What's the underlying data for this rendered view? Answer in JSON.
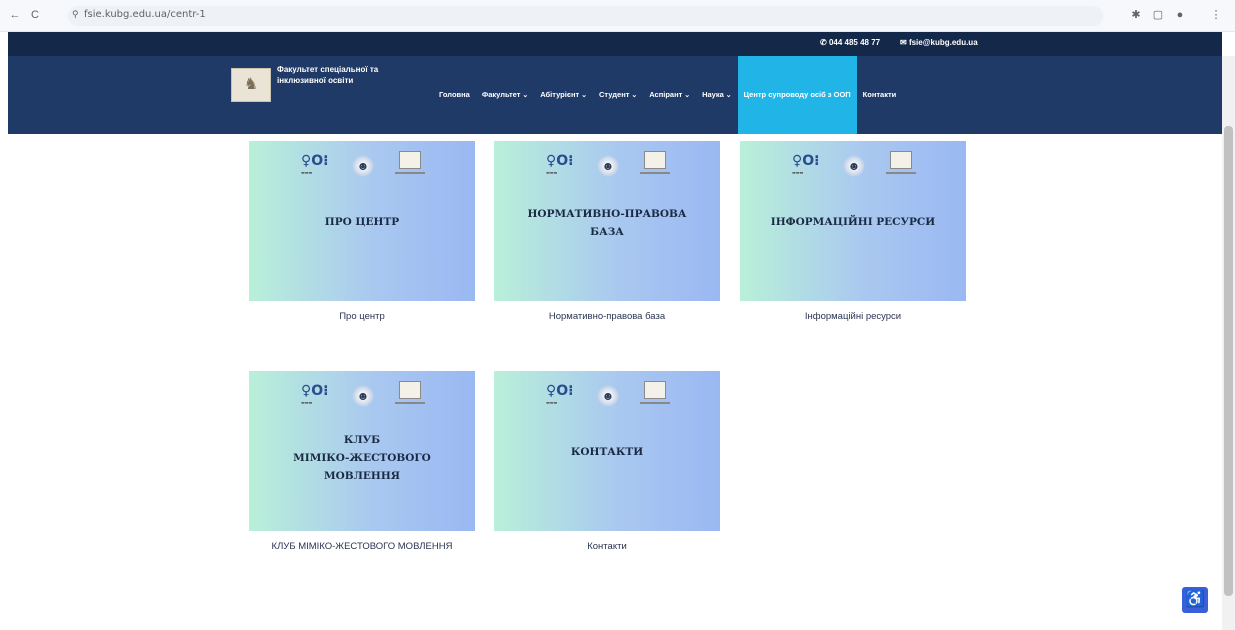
{
  "browser": {
    "back": "←",
    "reload": "C",
    "url": "fsie.kubg.edu.ua/centr-1",
    "right_icons": [
      "puzzle-icon",
      "window-icon",
      "profile-icon",
      "menu-icon"
    ]
  },
  "top_strip": {
    "phone": "044 485 48 77",
    "email": "fsie@kubg.edu.ua"
  },
  "header": {
    "logo_text": "Факультет спеціальної та інклюзивної освіти",
    "menu": [
      {
        "label": "Головна",
        "has_dropdown": false
      },
      {
        "label": "Факультет",
        "has_dropdown": true
      },
      {
        "label": "Абітурієнт",
        "has_dropdown": true
      },
      {
        "label": "Студент",
        "has_dropdown": true
      },
      {
        "label": "Аспірант",
        "has_dropdown": true
      },
      {
        "label": "Наука",
        "has_dropdown": true
      },
      {
        "label": "Центр супроводу осіб з ООП",
        "has_dropdown": false,
        "active": true
      },
      {
        "label": "Контакти",
        "has_dropdown": false
      }
    ]
  },
  "cards": [
    {
      "title_lines": [
        "ПРО ЦЕНТР"
      ],
      "caption": "Про центр"
    },
    {
      "title_lines": [
        "НОРМАТИВНО-ПРАВОВА",
        "БАЗА"
      ],
      "caption": "Нормативно-правова база"
    },
    {
      "title_lines": [
        "ІНФОРМАЦІЙНІ РЕСУРСИ"
      ],
      "caption": "Інформаційні ресурси"
    },
    {
      "title_lines": [
        "КЛУБ",
        "МІМІКО-ЖЕСТОВОГО",
        "МОВЛЕННЯ"
      ],
      "caption": "КЛУБ МІМІКО-ЖЕСТОВОГО МОВЛЕННЯ"
    },
    {
      "title_lines": [
        "КОНТАКТИ"
      ],
      "caption": "Контакти"
    }
  ],
  "colors": {
    "header_bg": "#1f3a66",
    "top_strip_bg": "#14284a",
    "active_menu_bg": "#21b4e6",
    "card_gradient_start": "#b9f0d9",
    "card_gradient_end": "#9ab8f2",
    "a11y_bg": "#3b5fd8"
  },
  "accessibility_icon": "wheelchair-icon"
}
